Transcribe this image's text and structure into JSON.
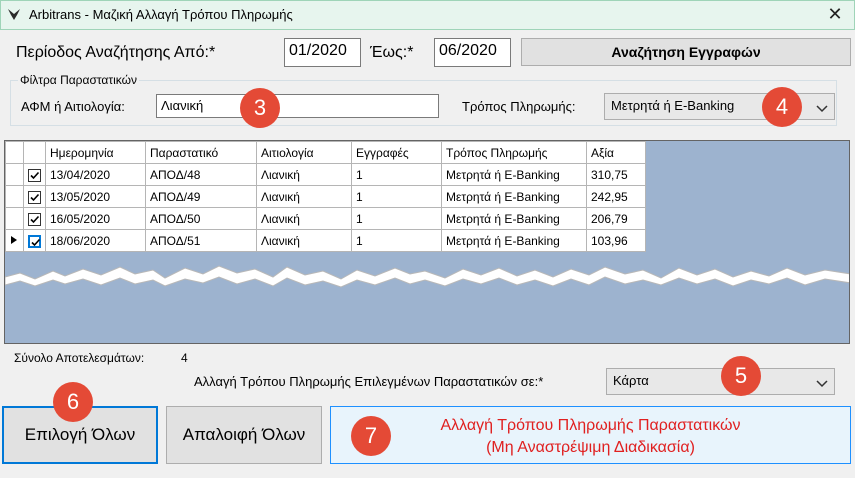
{
  "window": {
    "title": "Arbitrans - Μαζική Αλλαγή Τρόπου Πληρωμής",
    "close_glyph": "✕"
  },
  "search": {
    "period_from_label": "Περίοδος Αναζήτησης Από:*",
    "period_from_value": "01/2020",
    "period_to_label": "Έως:*",
    "period_to_value": "06/2020",
    "search_button": "Αναζήτηση Εγγραφών"
  },
  "filters": {
    "group_title": "Φίλτρα Παραστατικών",
    "afm_label": "ΑΦΜ ή Αιτιολογία:",
    "afm_value": "Λιανική",
    "payment_label": "Τρόπος Πληρωμής:",
    "payment_value": "Μετρητά ή E-Banking"
  },
  "grid": {
    "columns": [
      "",
      "Ημερομηνία",
      "Παραστατικό",
      "Αιτιολογία",
      "Εγγραφές",
      "Τρόπος Πληρωμής",
      "Αξία"
    ],
    "rows": [
      {
        "checked": true,
        "date": "13/04/2020",
        "doc": "ΑΠΟΔ/48",
        "reason": "Λιανική",
        "entries": "1",
        "payment": "Μετρητά ή E-Banking",
        "value": "310,75",
        "current": false
      },
      {
        "checked": true,
        "date": "13/05/2020",
        "doc": "ΑΠΟΔ/49",
        "reason": "Λιανική",
        "entries": "1",
        "payment": "Μετρητά ή E-Banking",
        "value": "242,95",
        "current": false
      },
      {
        "checked": true,
        "date": "16/05/2020",
        "doc": "ΑΠΟΔ/50",
        "reason": "Λιανική",
        "entries": "1",
        "payment": "Μετρητά ή E-Banking",
        "value": "206,79",
        "current": false
      },
      {
        "checked": true,
        "date": "18/06/2020",
        "doc": "ΑΠΟΔ/51",
        "reason": "Λιανική",
        "entries": "1",
        "payment": "Μετρητά ή E-Banking",
        "value": "103,96",
        "current": true
      }
    ]
  },
  "summary": {
    "total_label": "Σύνολο Αποτελεσμάτων:",
    "total_value": "4"
  },
  "change": {
    "label": "Αλλαγή Τρόπου Πληρωμής Επιλεγμένων Παραστατικών σε:*",
    "value": "Κάρτα"
  },
  "actions": {
    "select_all": "Επιλογή Όλων",
    "clear_all": "Απαλοιφή Όλων",
    "apply_line1": "Αλλαγή Τρόπου Πληρωμής Παραστατικών",
    "apply_line2": "(Μη Αναστρέψιμη Διαδικασία)"
  },
  "badges": {
    "b3": "3",
    "b4": "4",
    "b5": "5",
    "b6": "6",
    "b7": "7"
  },
  "colors": {
    "accent": "#0078d7",
    "badge": "#e44a36",
    "warning_text": "#e02020",
    "grid_background": "#9db3cf",
    "titlebar": "#e7f5ee"
  }
}
